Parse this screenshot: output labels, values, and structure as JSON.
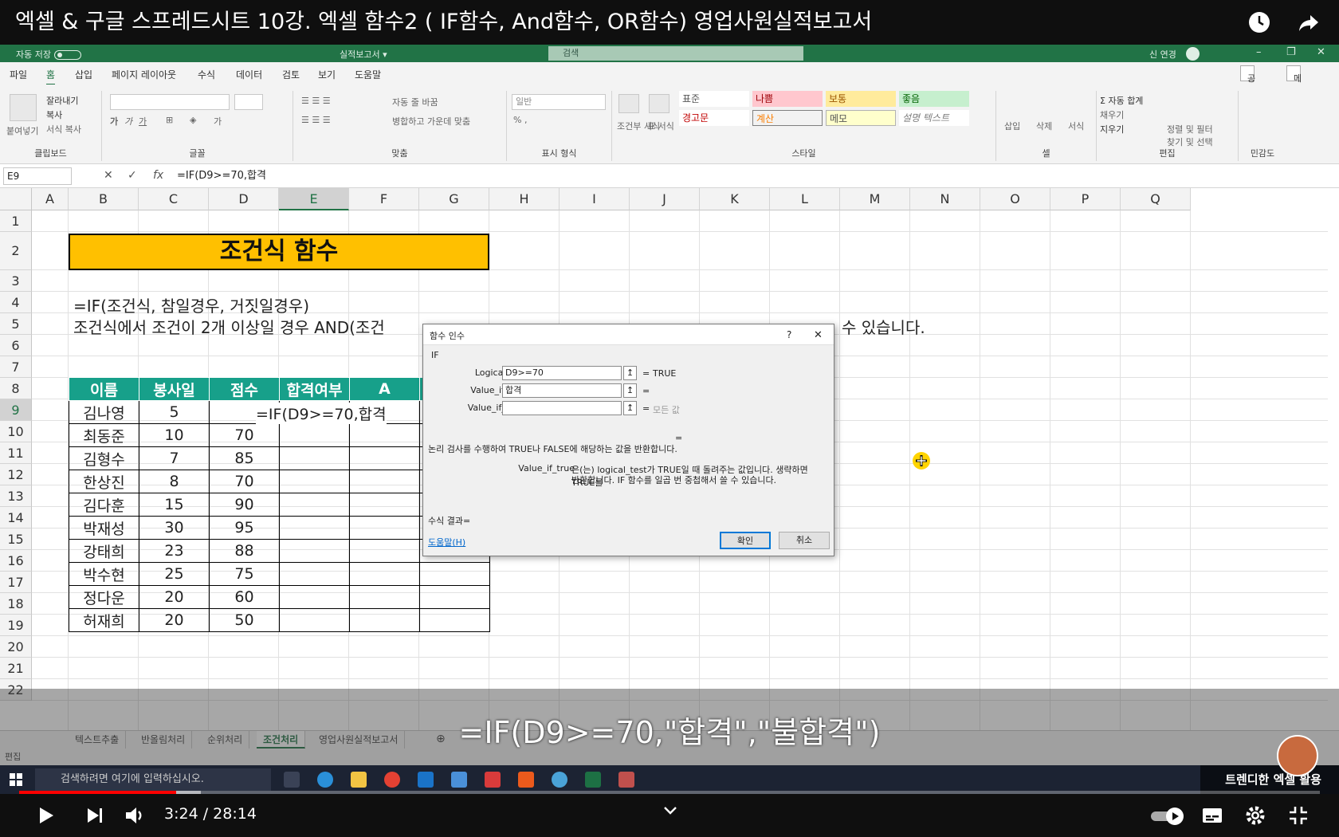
{
  "video": {
    "title": "엑셀 & 구글 스프레드시트 10강. 엑셀 함수2 ( IF함수, And함수, OR함수) 영업사원실적보고서",
    "time_current": "3:24",
    "time_sep": " / ",
    "time_total": "28:14",
    "progress": 0.121,
    "buffered": 0.14,
    "subtitle": "=IF(D9>=70,\"합격\",\"불합격\")",
    "channel": "트렌디한 엑셀 활용"
  },
  "excel": {
    "autosave_label": "자동 저장",
    "autosave_state": "끔",
    "doc_name": "실적보고서 ▾",
    "search_placeholder": "검색",
    "user_name": "신 연경",
    "tabs": [
      "파일",
      "홈",
      "삽입",
      "페이지 레이아웃",
      "수식",
      "데이터",
      "검토",
      "보기",
      "도움말"
    ],
    "share_label": "공유",
    "memo_label": "메모",
    "ribbon": {
      "paste": "붙여넣기",
      "cut": "잘라내기",
      "copy": "복사",
      "format_painter": "서식 복사",
      "clipboard": "클립보드",
      "font": "글꼴",
      "wrap": "자동 줄 바꿈",
      "merge": "병합하고 가운데 맞춤",
      "alignment": "맞춤",
      "number_format": "일반",
      "number": "표시 형식",
      "cond_format": "조건부 서식",
      "table_format": "표 서식",
      "styles_label": "스타일",
      "styles": [
        "표준",
        "나쁨",
        "보통",
        "좋음",
        "경고문",
        "계산",
        "메모",
        "설명 텍스트"
      ],
      "insert": "삽입",
      "delete": "삭제",
      "format": "서식",
      "cells": "셀",
      "autosum": "자동 합계",
      "fill": "채우기",
      "clear": "지우기",
      "sort": "정렬 및 필터",
      "find": "찾기 및 선택",
      "editing": "편집",
      "sensitivity": "민감도"
    },
    "name_box": "E9",
    "formula": "=IF(D9>=70,합격",
    "columns": [
      "A",
      "B",
      "C",
      "D",
      "E",
      "F",
      "G",
      "H",
      "I",
      "J",
      "K",
      "L",
      "M",
      "N",
      "O",
      "P",
      "Q"
    ],
    "rows": [
      "1",
      "2",
      "3",
      "4",
      "5",
      "6",
      "7",
      "8",
      "9",
      "10",
      "11",
      "12",
      "13",
      "14",
      "15",
      "16",
      "17",
      "18",
      "19",
      "20",
      "21",
      "22"
    ],
    "banner": "조건식 함수",
    "line4": "=IF(조건식, 참일경우, 거짓일경우)",
    "line5a": "조건식에서 조건이 2개 이상일 경우 AND(조건",
    "line5b": "수 있습니다.",
    "table_headers": [
      "이름",
      "봉사일",
      "점수",
      "합격여부",
      "A"
    ],
    "table_rows": [
      [
        "김나영",
        "5",
        ""
      ],
      [
        "최동준",
        "10",
        "70"
      ],
      [
        "김형수",
        "7",
        "85"
      ],
      [
        "한상진",
        "8",
        "70"
      ],
      [
        "김다훈",
        "15",
        "90"
      ],
      [
        "박재성",
        "30",
        "95"
      ],
      [
        "강태희",
        "23",
        "88"
      ],
      [
        "박수현",
        "25",
        "75"
      ],
      [
        "정다운",
        "20",
        "60"
      ],
      [
        "허재희",
        "20",
        "50"
      ]
    ],
    "editing_cell": "=IF(D9>=70,합격",
    "sheet_tabs": [
      "텍스트추출",
      "반올림처리",
      "순위처리",
      "조건처리",
      "영업사원실적보고서"
    ],
    "active_sheet": "조건처리",
    "status": "편집"
  },
  "dialog": {
    "title": "함수 인수",
    "help_q": "?",
    "close": "✕",
    "func": "IF",
    "args": [
      {
        "label": "Logical_test",
        "value": "D9>=70",
        "result": "TRUE"
      },
      {
        "label": "Value_if_true",
        "value": "합격",
        "result": ""
      },
      {
        "label": "Value_if_false",
        "value": "",
        "result": "모든 값"
      }
    ],
    "eq": "=",
    "desc": "논리 검사를 수행하여 TRUE나 FALSE에 해당하는 값을 반환합니다.",
    "arg_name": "Value_if_true",
    "arg_desc1": "은(는) logical_test가 TRUE일 때 돌려주는 값입니다. 생략하면 TRUE를",
    "arg_desc2": "반환합니다. IF 함수를 일곱 번 중첩해서 쓸 수 있습니다.",
    "result_label": "수식 결과=",
    "help_link": "도움말(H)",
    "ok": "확인",
    "cancel": "취소"
  },
  "taskbar": {
    "search": "검색하려면 여기에 입력하십시오."
  }
}
